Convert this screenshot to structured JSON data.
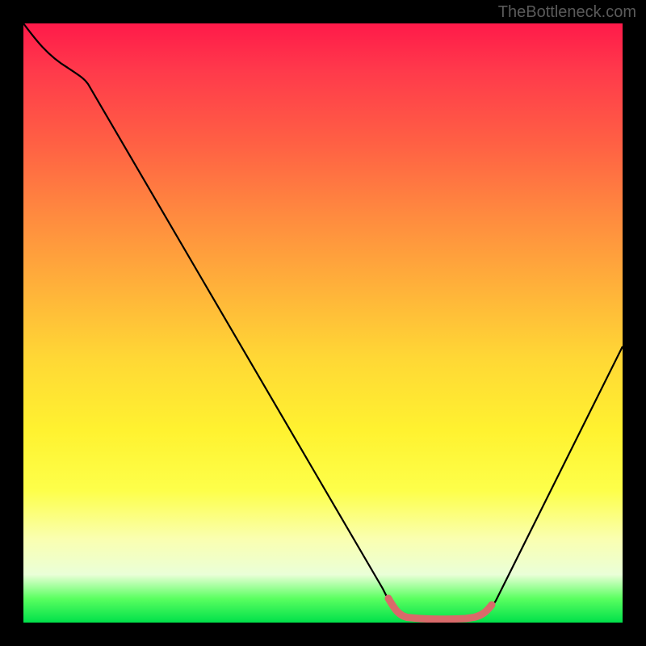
{
  "attribution": "TheBottleneck.com",
  "chart_data": {
    "type": "line",
    "title": "",
    "xlabel": "",
    "ylabel": "",
    "xlim": [
      0,
      100
    ],
    "ylim": [
      0,
      100
    ],
    "series": [
      {
        "name": "bottleneck-curve",
        "x": [
          0,
          3,
          7,
          10,
          20,
          30,
          40,
          50,
          60,
          62,
          65,
          68,
          72,
          75,
          78,
          85,
          92,
          100
        ],
        "y": [
          100,
          97,
          93,
          92,
          78,
          63.5,
          49,
          34.5,
          10,
          3,
          1,
          0.5,
          0.5,
          0.5,
          1,
          10,
          25,
          46
        ],
        "color": "#000000"
      }
    ],
    "annotations": [
      {
        "name": "highlight-segment",
        "x_start": 61,
        "x_end": 78,
        "color": "#e57373"
      }
    ]
  }
}
